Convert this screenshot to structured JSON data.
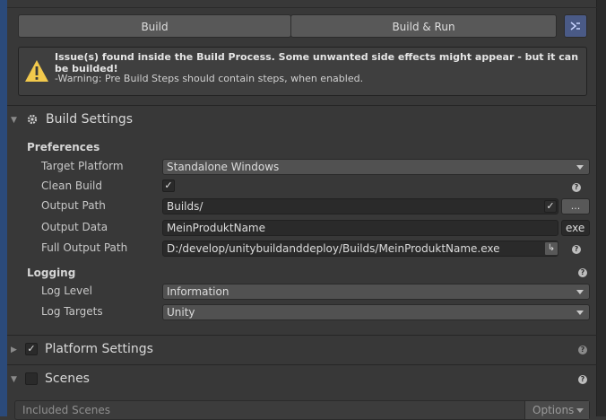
{
  "toolbar": {
    "build_label": "Build",
    "build_run_label": "Build & Run",
    "extra_icon": "branch-icon"
  },
  "help": {
    "title": "Issue(s) found inside the Build Process. Some unwanted side effects might appear - but it can be builded!",
    "warning": "-Warning: Pre Build Steps should contain steps, when enabled.",
    "icon": "warning-icon",
    "warning_color": "#f2c94c"
  },
  "build_settings": {
    "title": "Build Settings",
    "icon": "gear-icon",
    "preferences": {
      "heading": "Preferences",
      "target_platform": {
        "label": "Target Platform",
        "value": "Standalone Windows"
      },
      "clean_build": {
        "label": "Clean Build",
        "checked": true
      },
      "output_path": {
        "label": "Output Path",
        "value": "Builds/",
        "browse": "..."
      },
      "output_data": {
        "label": "Output Data",
        "value": "MeinProduktName",
        "ext": "exe"
      },
      "full_output_path": {
        "label": "Full Output Path",
        "value": "D:/develop/unitybuildanddeploy/Builds/MeinProduktName.exe"
      }
    },
    "logging": {
      "heading": "Logging",
      "log_level": {
        "label": "Log Level",
        "value": "Information"
      },
      "log_targets": {
        "label": "Log Targets",
        "value": "Unity"
      }
    }
  },
  "platform_settings": {
    "title": "Platform Settings",
    "enabled": true
  },
  "scenes": {
    "title": "Scenes",
    "enabled": false,
    "included_label": "Included Scenes",
    "options_label": "Options"
  }
}
